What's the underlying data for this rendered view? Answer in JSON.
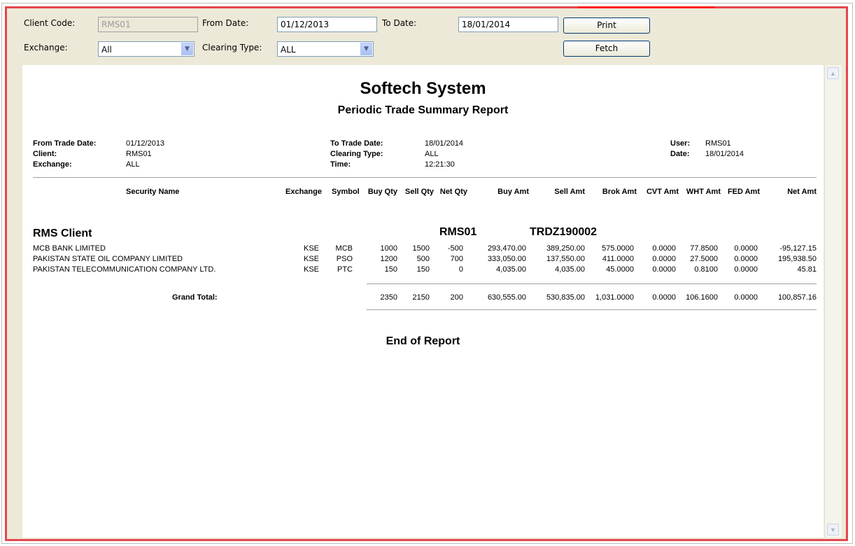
{
  "form": {
    "client_code_label": "Client Code:",
    "client_code_value": "RMS01",
    "from_date_label": "From Date:",
    "from_date_value": "01/12/2013",
    "to_date_label": "To Date:",
    "to_date_value": "18/01/2014",
    "print_label": "Print",
    "exchange_label": "Exchange:",
    "exchange_value": "All",
    "clearing_type_label": "Clearing Type:",
    "clearing_type_value": "ALL",
    "fetch_label": "Fetch"
  },
  "report": {
    "title": "Softech System",
    "subtitle": "Periodic Trade Summary Report",
    "meta": {
      "from_trade_date_label": "From Trade Date:",
      "from_trade_date": "01/12/2013",
      "client_label": "Client:",
      "client": "RMS01",
      "exchange_label": "Exchange:",
      "exchange": "ALL",
      "to_trade_date_label": "To Trade Date:",
      "to_trade_date": "18/01/2014",
      "clearing_type_label": "Clearing Type:",
      "clearing_type": "ALL",
      "time_label": "Time:",
      "time": "12:21:30",
      "user_label": "User:",
      "user": "RMS01",
      "date_label": "Date:",
      "date": "18/01/2014"
    },
    "columns": [
      "Security Name",
      "Exchange",
      "Symbol",
      "Buy Qty",
      "Sell Qty",
      "Net Qty",
      "Buy Amt",
      "Sell Amt",
      "Brok Amt",
      "CVT Amt",
      "WHT Amt",
      "FED Amt",
      "Net Amt"
    ],
    "group": {
      "name": "RMS Client",
      "code": "RMS01",
      "ref": "TRDZ190002"
    },
    "rows": [
      [
        "MCB BANK LIMITED",
        "KSE",
        "MCB",
        "1000",
        "1500",
        "-500",
        "293,470.00",
        "389,250.00",
        "575.0000",
        "0.0000",
        "77.8500",
        "0.0000",
        "-95,127.15"
      ],
      [
        "PAKISTAN STATE OIL COMPANY LIMITED",
        "KSE",
        "PSO",
        "1200",
        "500",
        "700",
        "333,050.00",
        "137,550.00",
        "411.0000",
        "0.0000",
        "27.5000",
        "0.0000",
        "195,938.50"
      ],
      [
        "PAKISTAN TELECOMMUNICATION COMPANY LTD.",
        "KSE",
        "PTC",
        "150",
        "150",
        "0",
        "4,035.00",
        "4,035.00",
        "45.0000",
        "0.0000",
        "0.8100",
        "0.0000",
        "45.81"
      ]
    ],
    "grand_total": {
      "label": "Grand Total:",
      "values": [
        "2350",
        "2150",
        "200",
        "630,555.00",
        "530,835.00",
        "1,031.0000",
        "0.0000",
        "106.1600",
        "0.0000",
        "100,857.16"
      ]
    },
    "end_text": "End of Report"
  },
  "scrollbar": {
    "up_icon": "▲",
    "down_icon": "▼"
  },
  "colors": {
    "frame": "#e2474f",
    "panel": "#ece9d8"
  }
}
